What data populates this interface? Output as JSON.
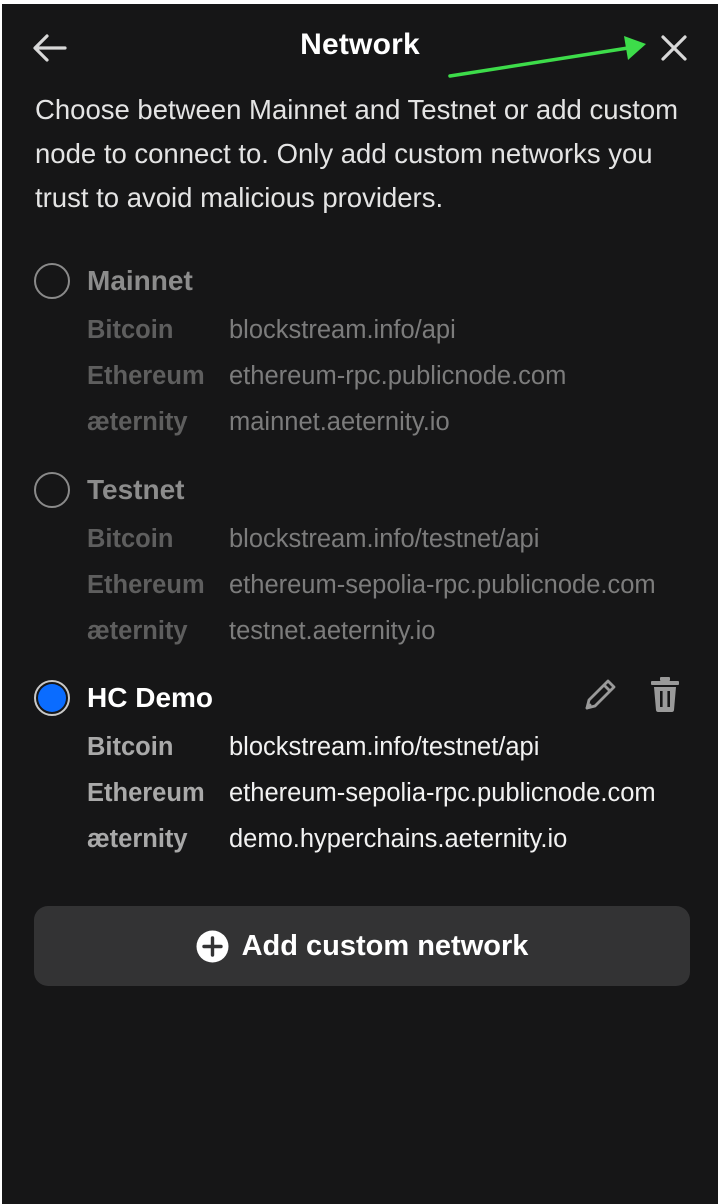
{
  "header": {
    "title": "Network",
    "back_icon": "arrow-left-icon",
    "close_icon": "close-icon"
  },
  "description": "Choose between Mainnet and Testnet or add custom node to connect to. Only add custom networks you trust to avoid malicious providers.",
  "networks": [
    {
      "name": "Mainnet",
      "selected": false,
      "rows": [
        {
          "label": "Bitcoin",
          "value": "blockstream.info/api"
        },
        {
          "label": "Ethereum",
          "value": "ethereum-rpc.publicnode.com"
        },
        {
          "label": "æternity",
          "value": "mainnet.aeternity.io"
        }
      ]
    },
    {
      "name": "Testnet",
      "selected": false,
      "rows": [
        {
          "label": "Bitcoin",
          "value": "blockstream.info/testnet/api"
        },
        {
          "label": "Ethereum",
          "value": "ethereum-sepolia-rpc.publicnode.com"
        },
        {
          "label": "æternity",
          "value": "testnet.aeternity.io"
        }
      ]
    },
    {
      "name": "HC Demo",
      "selected": true,
      "editable": true,
      "rows": [
        {
          "label": "Bitcoin",
          "value": "blockstream.info/testnet/api"
        },
        {
          "label": "Ethereum",
          "value": "ethereum-sepolia-rpc.publicnode.com"
        },
        {
          "label": "æternity",
          "value": "demo.hyperchains.aeternity.io"
        }
      ]
    }
  ],
  "add_button": {
    "label": "Add custom network",
    "icon": "plus-circle-icon"
  },
  "colors": {
    "background": "#161617",
    "accent_radio": "#0a6cff",
    "annotation_arrow": "#3ddc4a",
    "button_bg": "#333334"
  }
}
